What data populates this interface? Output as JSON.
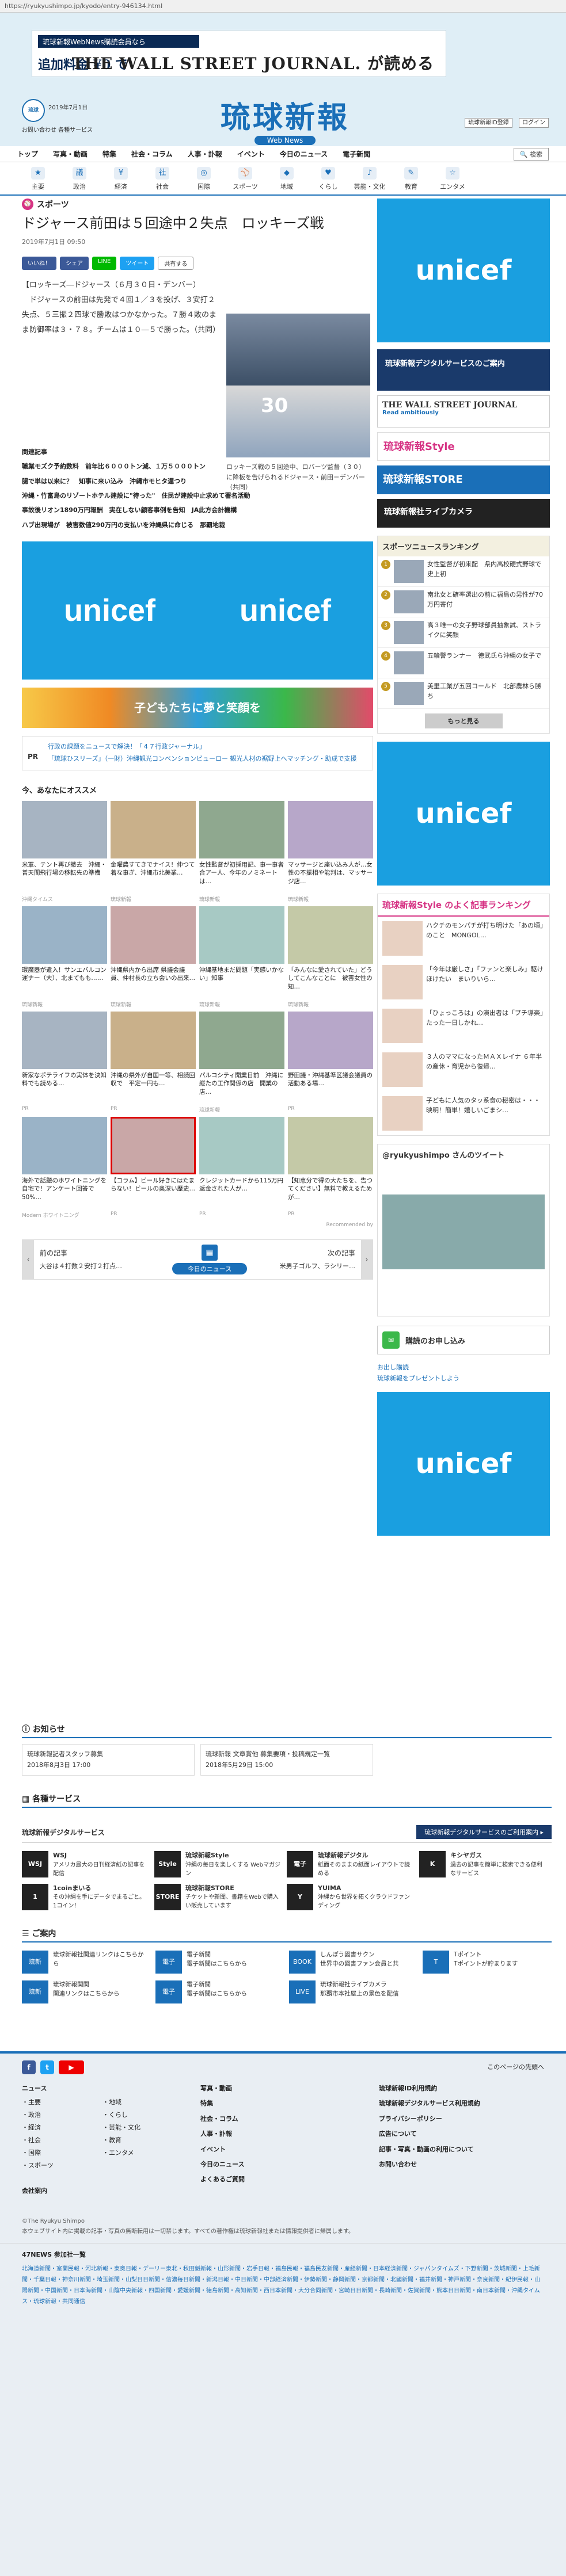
{
  "browser": {
    "url": "https://ryukyushimpo.jp/kyodo/entry-946134.html"
  },
  "ad_top": {
    "line1": "琉球新報WebNews購読会員なら",
    "line2": "追加料金 ¥0 で",
    "line3": "THE WALL STREET JOURNAL. が読める"
  },
  "header": {
    "mini_logo": "琉球",
    "date": "2019年7月1日",
    "links": "お問い合わせ  各種サービス",
    "logo": "琉球新報",
    "logo_sub": "Web News",
    "right_links": [
      "琉球新報ID登録",
      "ログイン"
    ]
  },
  "gnav": [
    "トップ",
    "写真・動画",
    "特集",
    "社会・コラム",
    "人事・訃報",
    "イベント",
    "今日のニュース",
    "電子新聞"
  ],
  "gnav_search": "検索",
  "subnav": [
    {
      "label": "主要",
      "icon": "★"
    },
    {
      "label": "政治",
      "icon": "議"
    },
    {
      "label": "経済",
      "icon": "¥"
    },
    {
      "label": "社会",
      "icon": "社"
    },
    {
      "label": "国際",
      "icon": "◎"
    },
    {
      "label": "スポーツ",
      "icon": "⚾"
    },
    {
      "label": "地域",
      "icon": "◆"
    },
    {
      "label": "くらし",
      "icon": "♥"
    },
    {
      "label": "芸能・文化",
      "icon": "♪"
    },
    {
      "label": "教育",
      "icon": "✎"
    },
    {
      "label": "エンタメ",
      "icon": "☆"
    }
  ],
  "article": {
    "category": "スポーツ",
    "title": "ドジャース前田は５回途中２失点　ロッキーズ戦",
    "date": "2019年7月1日 09:50",
    "share": [
      "いいね！",
      "シェア",
      "LINE",
      "ツイート",
      "共有する"
    ],
    "body1": "【ロッキーズ―ドジャース（６月３０日・デンバー）",
    "body2": "ドジャースの前田は先発で４回１／３を投げ、３安打２失点、５三振２四球で勝敗はつかなかった。７勝４敗のまま防御率は３・７８。チームは１０―５で勝った。（共同）",
    "photo_caption": "ロッキーズ戦の５回途中、ロバーツ監督（３０）に降板を告げられるドジャース・前田＝デンバー（共同）",
    "photo_number": "30",
    "credit": "（共同通信）"
  },
  "related": {
    "heading": "関連記事",
    "items": [
      "職業モズク予約数料　前年比６０００トン減、１万５０００トン",
      "腸で単は以来に？　知事に来い込み　沖縄市モヒタ遅つり",
      "沖縄・竹富島のリゾートホテル建設に\"待った\"　住民が建設中止求めて署名活動",
      "事故後リオン1890万円報酬　実在しない顧客事例を告知　JA此方会計機構",
      "ハブ出現場が　被害数値290万円の支払いを沖縄県に命じる　那覇地裁"
    ]
  },
  "ads": {
    "unicef": "unicef",
    "band": "子どもたちに夢と笑顔を"
  },
  "pr": {
    "label": "PR",
    "lines": [
      "行政の課題をニュースで解決！「４７行政ジャーナル」",
      "「琉球ひスリーズ」（一財）沖縄観光コンベンションビューロー 観光人材の裾野上へマッチング・助成で支援"
    ]
  },
  "osusume": {
    "heading": "今、あなたにオススメ",
    "cards": [
      {
        "title": "米軍、テント再び撤去　沖縄・普天間飛行場の移転先の準備",
        "src": "沖縄タイムス"
      },
      {
        "title": "金曜農すてきでナイス！仲つて着な事ぎ、沖縄市北美業…",
        "src": "琉球新報"
      },
      {
        "title": "女性監督が初採用記、事一事者合アー人、今年のノミネートは…",
        "src": "琉球新報"
      },
      {
        "title": "マッサージと座い込み人が…女性の不振相や能判は、マッサージ店…",
        "src": "琉球新報"
      },
      {
        "title": "環魔器が遣入！サンエバルコン運ナー（大）、北まてもも……",
        "src": "琉球新報"
      },
      {
        "title": "沖縄県内から出席 県議会議員、仲村長の立ち会いの出来…",
        "src": "琉球新報"
      },
      {
        "title": "沖縄基地まだ問題「実感いかない」知事",
        "src": "琉球新報"
      },
      {
        "title": "「みんなに愛されていた」どうしてこんなことに　被害女性の知…",
        "src": "琉球新報"
      },
      {
        "title": "新家なポテライフの実体を決知料でも読める…",
        "src": "PR"
      },
      {
        "title": "沖縄の県外が自国一等、相続回収で　平定一円も…",
        "src": "PR"
      },
      {
        "title": "パルコシティ開業日前　沖縄に縦たの工作関係の店　開業の店…",
        "src": "琉球新報"
      },
      {
        "title": "野田議・沖縄基準区議会議員の活動ある場…",
        "src": "PR"
      },
      {
        "title": "海外で話題のホワイトニングを自宅で！アンケート回答で50%…",
        "src": "Modern ホワイトニング"
      },
      {
        "title": "【コラム】ビール好きにはたまらない！ビールの奥深い歴史…",
        "src": "PR"
      },
      {
        "title": "クレジットカードから115万円返金された人が…",
        "src": "PR"
      },
      {
        "title": "【知恵分で得の大たちを、告つてください】無料で教えるためが…",
        "src": "PR"
      }
    ],
    "recby": "Recommended by"
  },
  "pager": {
    "prev_label": "前の記事",
    "prev_title": "大谷は４打数２安打２打点…",
    "next_label": "次の記事",
    "next_title": "米男子ゴルフ、ラシリー…",
    "today": "今日のニュース"
  },
  "side": {
    "digital": "琉球新報デジタルサービスのご案内",
    "wsj": "THE WALL STREET JOURNAL",
    "wsj_sub": "Read ambitiously",
    "style": "琉球新報Style",
    "store": "琉球新報STORE",
    "camera": "琉球新報社ライブカメラ",
    "ranking_heading": "スポーツニュースランキング",
    "ranking": [
      "女性監督が初来配　県内高校硬式野球で史上初",
      "南北女と確率選出の前に福島の男性が70万円寄付",
      "高３唯一の女子野球部員抽象試、ストライクに笑顔",
      "五輪警ランナー　徳武氏ら沖縄の女子で",
      "美里工業が五回コールド　北部農林ら勝ち"
    ],
    "more": "もっと見る",
    "style_rank_heading": "琉球新報Style のよく記事ランキング",
    "style_rank": [
      "ハクチのモンパチが打ち明けた「あの頃」のこと　MONGOL…",
      "「今年は厳しさ」「ファンと楽しみ」駆けほけたい　まいりいら…",
      "「ひょっころは」の演出者は「プチ導楽」たった一日しかれ…",
      "３人のママになったＭＡＸレイナ ６年半の産休・育児から復帰…",
      "子どもに人気のタッ系食の秘密は・・・映明！簡単！嬉しいごまシ…"
    ],
    "twitter_heading": "@ryukyushimpo さんのツイート",
    "buy": "購読のお申し込み",
    "present": "お出し購読\n琉球新報をプレゼントしよう"
  },
  "oshirase": {
    "heading": "お知らせ",
    "items": [
      {
        "title": "琉球新報記者スタッフ募集",
        "date": "2018年8月3日 17:00"
      },
      {
        "title": "琉球新報 文章賞他 募集要項・投稿規定一覧",
        "date": "2018年5月29日 15:00"
      }
    ]
  },
  "services": {
    "heading": "各種サービス",
    "bar_left": "琉球新報デジタルサービス",
    "bar_right": "琉球新報デジタルサービスのご利用案内 ▸",
    "items": [
      {
        "icon": "WSJ",
        "name": "WSJ",
        "desc": "アメリカ最大の日刊経済紙の記事を配信"
      },
      {
        "icon": "Style",
        "name": "琉球新報Style",
        "desc": "沖縄の毎日を楽しくする Webマガジン"
      },
      {
        "icon": "電子",
        "name": "琉球新報デジタル",
        "desc": "紙面そのままの紙面レイアウトで読める"
      },
      {
        "icon": "K",
        "name": "キシヤガス",
        "desc": "過去の記事を簡単に検索できる便利なサービス"
      },
      {
        "icon": "1",
        "name": "1coinまいる",
        "desc": "その沖縄を手にデータでまるごと。1コイン！"
      },
      {
        "icon": "STORE",
        "name": "琉球新報STORE",
        "desc": "チケットや新聞、書籍をWebで購入い販売しています"
      },
      {
        "icon": "Y",
        "name": "YUIMA",
        "desc": "沖縄から世界を拓くクラウドファンディング"
      }
    ]
  },
  "guide": {
    "heading": "ご案内",
    "items": [
      {
        "icon": "琉新",
        "desc": "琉球新報社関連リンクはこちらから"
      },
      {
        "icon": "電子",
        "desc": "電子新聞\n電子新聞はこちらから"
      },
      {
        "icon": "BOOK",
        "desc": "しんぽう図書サクン\n世界中の図書ファン会員と共"
      },
      {
        "icon": "T",
        "desc": "Tポイント\nTポイントが貯まります"
      },
      {
        "icon": "琉新",
        "desc": "琉球新報関関\n関連リンクはこちらから"
      },
      {
        "icon": "電子",
        "desc": "電子新聞\n電子新聞はこちらから"
      },
      {
        "icon": "LIVE",
        "desc": "琉球新報社ライブカメラ\n那覇市本社屋上の景色を配信"
      }
    ]
  },
  "footer": {
    "page_top": "このページの先頭へ",
    "col1_title": "ニュース",
    "col1": [
      "主要",
      "地域",
      "政治",
      "くらし",
      "経済",
      "芸能・文化",
      "社会",
      "教育",
      "国際",
      "エンタメ",
      "スポーツ"
    ],
    "col2": [
      "写真・動画",
      "特集",
      "社会・コラム",
      "人事・訃報",
      "イベント",
      "今日のニュース"
    ],
    "col3": [
      "琉球新報ID利用規約",
      "琉球新報デジタルサービス利用規約",
      "プライバシーポリシー",
      "広告について",
      "記事・写真・動画の利用について"
    ],
    "company": "会社案内",
    "faq": "よくあるご質問",
    "contact": "お問い合わせ",
    "copyright": "©The Ryukyu Shimpo\n本ウェブサイト内に掲載の記事・写真の無断転用は一切禁じます。すべての著作権は琉球新報社または情報提供者に帰属します。",
    "news_heading": "47NEWS 参加社一覧",
    "news_list": "北海道新聞・室蘭民報・河北新報・東奥日報・デーリー東北・秋田魁新報・山形新聞・岩手日報・福島民報・福島民友新聞・産経新聞・日本経済新聞・ジャパンタイムズ・下野新聞・茨城新聞・上毛新聞・千葉日報・神奈川新聞・埼玉新聞・山梨日日新聞・信濃毎日新聞・新潟日報・中日新聞・中部経済新聞・伊勢新聞・静岡新聞・京都新聞・北國新聞・福井新聞・神戸新聞・奈良新聞・紀伊民報・山陽新聞・中国新聞・日本海新聞・山陰中央新報・四国新聞・愛媛新聞・徳島新聞・高知新聞・西日本新聞・大分合同新聞・宮崎日日新聞・長崎新聞・佐賀新聞・熊本日日新聞・南日本新聞・沖縄タイムス・琉球新報・共同通信"
  },
  "colors": {
    "brand": "#1a6fb8",
    "unicef": "#1a9fe0",
    "navy": "#0a2a55"
  }
}
